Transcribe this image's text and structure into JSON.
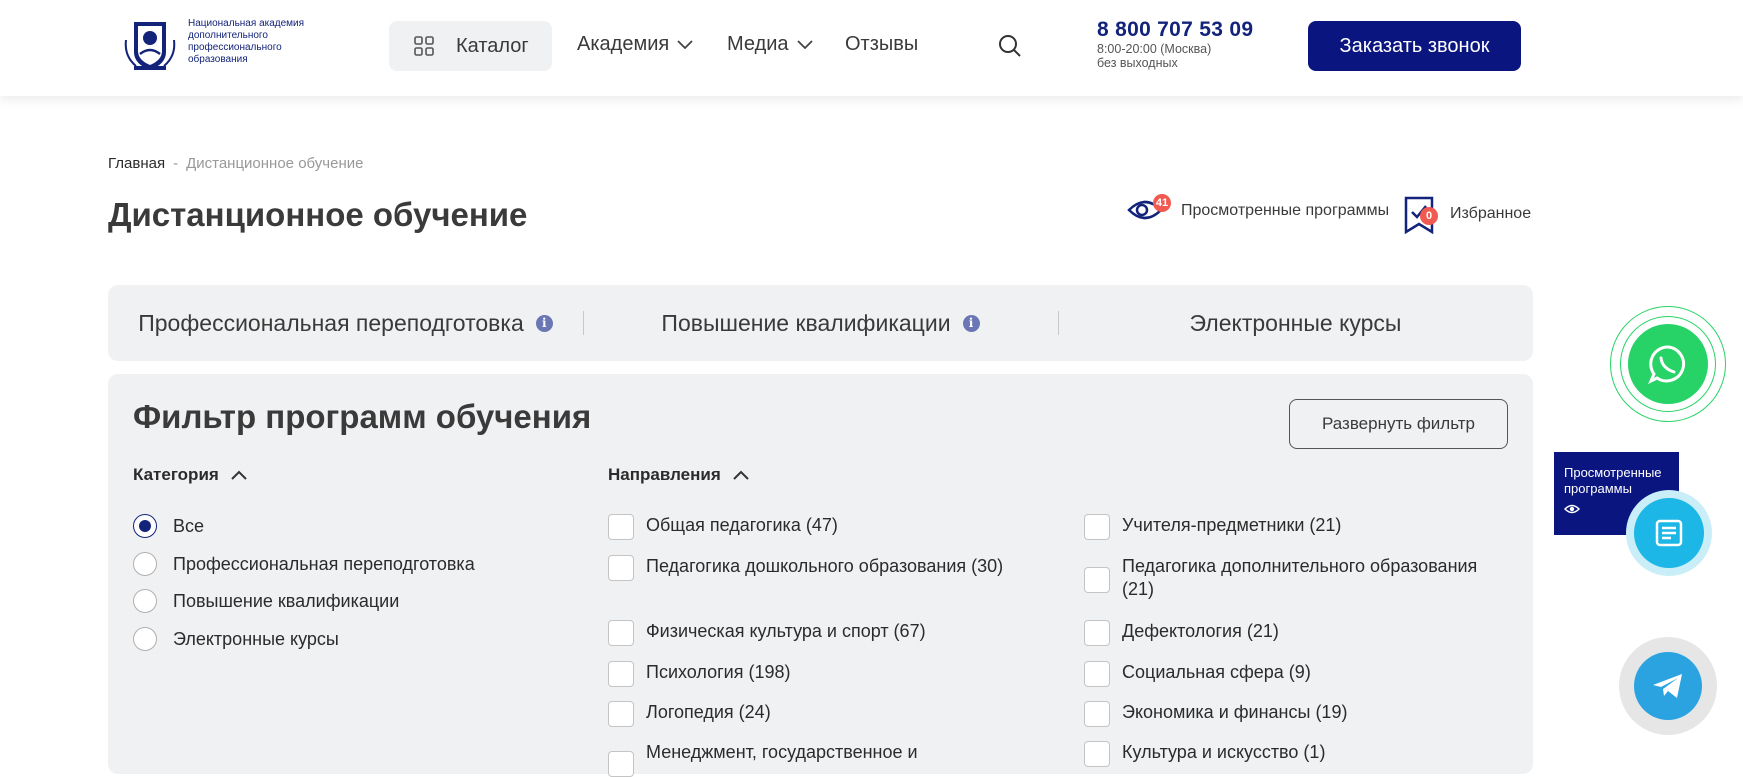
{
  "header": {
    "logo_text": "Национальная академия дополнительного профессионального образования",
    "catalog": "Каталог",
    "nav": [
      "Академия",
      "Медиа",
      "Отзывы"
    ],
    "phone": "8 800 707 53 09",
    "hours": "8:00-20:00 (Москва)",
    "days": "без выходных",
    "call_button": "Заказать звонок"
  },
  "breadcrumb": {
    "home": "Главная",
    "sep": "-",
    "current": "Дистанционное обучение"
  },
  "page_title": "Дистанционное обучение",
  "top_links": {
    "viewed_label": "Просмотренные программы",
    "viewed_count": "41",
    "favorites_label": "Избранное",
    "favorites_count": "0"
  },
  "tabs": [
    "Профессиональная переподготовка",
    "Повышение квалификации",
    "Электронные курсы"
  ],
  "filter": {
    "title": "Фильтр программ обучения",
    "expand_button": "Развернуть фильтр",
    "category_title": "Категория",
    "categories": [
      "Все",
      "Профессиональная переподготовка",
      "Повышение квалификации",
      "Электронные курсы"
    ],
    "selected_category": "Все",
    "directions_title": "Направления",
    "directions_left": [
      "Общая педагогика (47)",
      "Педагогика дошкольного образования (30)",
      "Физическая культура и спорт (67)",
      "Психология (198)",
      "Логопедия (24)",
      "Менеджмент, государственное и"
    ],
    "directions_right": [
      "Учителя-предметники (21)",
      "Педагогика дополнительного образования (21)",
      "Дефектология (21)",
      "Социальная сфера (9)",
      "Экономика и финансы (19)",
      "Культура и искусство (1)"
    ]
  },
  "side": {
    "viewed_programs": "Просмотренные программы"
  },
  "colors": {
    "brand": "#0a1580",
    "whatsapp": "#27d366",
    "telegram": "#2aa3e0",
    "badge": "#f05a50"
  }
}
